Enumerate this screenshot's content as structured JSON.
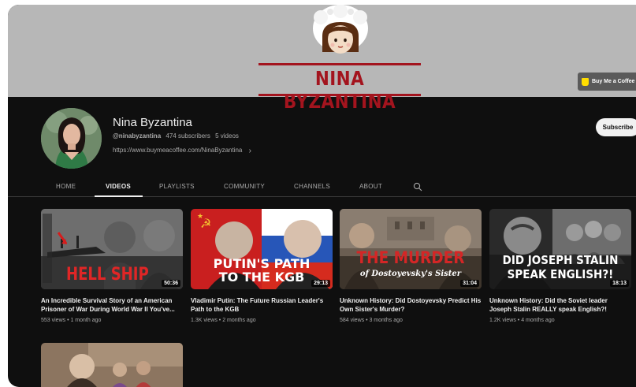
{
  "banner": {
    "title": "NINA BYZANTINA",
    "bmc_label": "Buy Me a Coffee",
    "colors": {
      "background": "#b7b7b7",
      "accent": "#a3141e"
    }
  },
  "channel": {
    "name": "Nina Byzantina",
    "handle": "@ninabyzantina",
    "subscribers": "474 subscribers",
    "video_count": "5 videos",
    "link": "https://www.buymeacoffee.com/NinaByzantina",
    "subscribe_label": "Subscribe"
  },
  "tabs": [
    {
      "label": "HOME"
    },
    {
      "label": "VIDEOS",
      "active": true
    },
    {
      "label": "PLAYLISTS"
    },
    {
      "label": "COMMUNITY"
    },
    {
      "label": "CHANNELS"
    },
    {
      "label": "ABOUT"
    }
  ],
  "videos": [
    {
      "title": "An Incredible Survival Story of an American Prisoner of War During World War II You've...",
      "meta": "553 views • 1 month ago",
      "duration": "50:36",
      "thumb_text": "HELL SHIP"
    },
    {
      "title": "Vladimir Putin: The Future Russian Leader's Path to the KGB",
      "meta": "1.3K views • 2 months ago",
      "duration": "29:13",
      "thumb_text_1": "PUTIN'S PATH",
      "thumb_text_2": "TO THE KGB"
    },
    {
      "title": "Unknown History: Did Dostoyevsky Predict His Own Sister's Murder?",
      "meta": "584 views • 3 months ago",
      "duration": "31:04",
      "thumb_text_1": "THE MURDER",
      "thumb_text_2": "of Dostoyevsky's Sister"
    },
    {
      "title": "Unknown History: Did the Soviet leader Joseph Stalin REALLY speak English?!",
      "meta": "1.2K views • 4 months ago",
      "duration": "18:13",
      "thumb_text_1": "DID JOSEPH STALIN",
      "thumb_text_2": "SPEAK ENGLISH?!"
    }
  ],
  "icons": {
    "search": "search-icon",
    "chevron": "chevron-right-icon",
    "coffee": "coffee-cup-icon"
  }
}
